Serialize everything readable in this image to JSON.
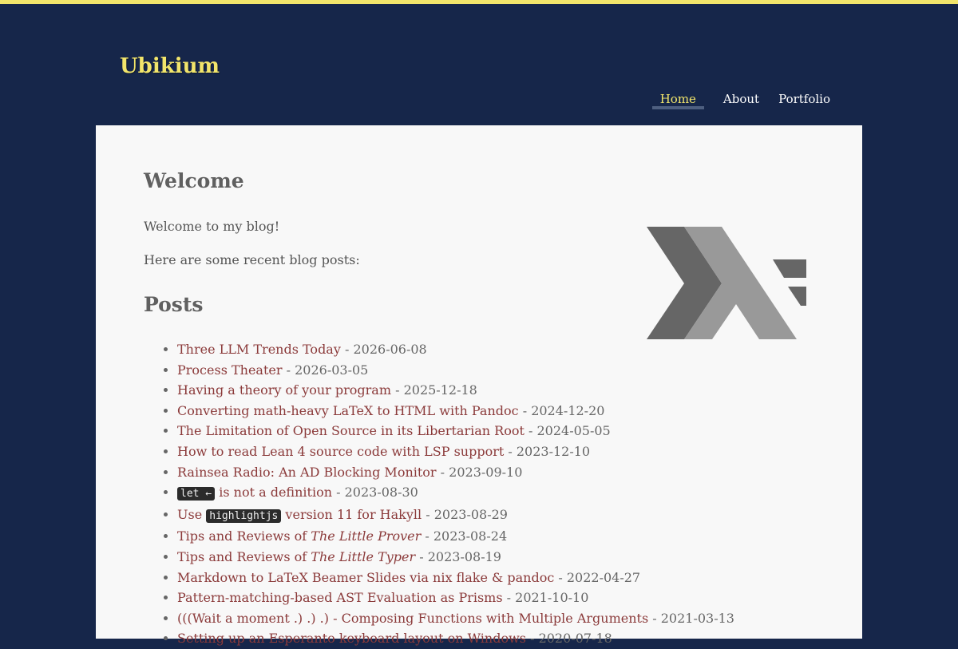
{
  "site": {
    "title": "Ubikium"
  },
  "nav": {
    "home": "Home",
    "about": "About",
    "portfolio": "Portfolio"
  },
  "page": {
    "heading": "Welcome",
    "welcome": "Welcome to my blog!",
    "intro": "Here are some recent blog posts:",
    "posts_heading": "Posts"
  },
  "posts": [
    {
      "title": "Three LLM Trends Today",
      "date": " - 2026-06-08"
    },
    {
      "title": "Process Theater",
      "date": " - 2026-03-05"
    },
    {
      "title": "Having a theory of your program",
      "date": " - 2025-12-18"
    },
    {
      "title": "Converting math-heavy LaTeX to HTML with Pandoc",
      "date": " - 2024-12-20"
    },
    {
      "title": "The Limitation of Open Source in its Libertarian Root",
      "date": " - 2024-05-05"
    },
    {
      "title": "How to read Lean 4 source code with LSP support",
      "date": " - 2023-12-10"
    },
    {
      "title": "Rainsea Radio: An AD Blocking Monitor",
      "date": " - 2023-09-10"
    },
    {
      "code": "let ←",
      "title": " is not a definition",
      "date": " - 2023-08-30"
    },
    {
      "pre": "Use ",
      "code": "highlightjs",
      "title": " version 11 for Hakyll",
      "date": " - 2023-08-29"
    },
    {
      "pre": "Tips and Reviews of ",
      "em": "The Little Prover",
      "date": " - 2023-08-24"
    },
    {
      "pre": "Tips and Reviews of ",
      "em": "The Little Typer",
      "date": " - 2023-08-19"
    },
    {
      "title": "Markdown to LaTeX Beamer Slides via nix flake & pandoc",
      "date": " - 2022-04-27"
    },
    {
      "title": "Pattern-matching-based AST Evaluation as Prisms",
      "date": " - 2021-10-10"
    },
    {
      "title": "(((Wait a moment .) .) .) - Composing Functions with Multiple Arguments",
      "date": " - 2021-03-13"
    },
    {
      "title": "Setting up an Esperanto keyboard layout on Windows",
      "date": " - 2020-07-18"
    }
  ],
  "logo": {
    "icon": "haskell-logo-icon",
    "colors": [
      "#666666",
      "#999999"
    ]
  },
  "colors": {
    "background": "#16264a",
    "accent": "#f2e56b",
    "link": "#8b3a3a",
    "panel": "#f8f8f8"
  }
}
